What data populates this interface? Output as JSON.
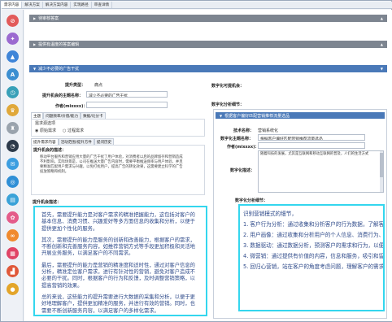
{
  "tabs": [
    "需求内容",
    "解决方案",
    "解决方案内容",
    "实现路径",
    "审查详情"
  ],
  "sidebar_icons": [
    {
      "name": "ban-icon",
      "color": "#e25a5a",
      "glyph": "⊘"
    },
    {
      "name": "puzzle-icon",
      "color": "#9b6ad0",
      "glyph": "✦"
    },
    {
      "name": "mountain-icon",
      "color": "#3f85d8",
      "glyph": "▲"
    },
    {
      "name": "abc-icon",
      "color": "#3c8fd1",
      "glyph": "A"
    },
    {
      "name": "clock-icon",
      "color": "#38a0b8",
      "glyph": "◷"
    },
    {
      "name": "trophy-icon",
      "color": "#e0a83a",
      "glyph": "♛"
    },
    {
      "name": "tower-icon",
      "color": "#9aa3ad",
      "glyph": "♜"
    },
    {
      "name": "gauge-icon",
      "color": "#2d3a4a",
      "glyph": "◔"
    },
    {
      "name": "chat-icon",
      "color": "#3d9ee0",
      "glyph": "✉"
    },
    {
      "name": "globe-icon",
      "color": "#2f8fd6",
      "glyph": "◎"
    },
    {
      "name": "document-icon",
      "color": "#3aa2d8",
      "glyph": "▤"
    },
    {
      "name": "palette-icon",
      "color": "#e45c8a",
      "glyph": "✿"
    },
    {
      "name": "link-icon",
      "color": "#f08a2e",
      "glyph": "∞"
    },
    {
      "name": "building-icon",
      "color": "#e04466",
      "glyph": "▦"
    },
    {
      "name": "podium-icon",
      "color": "#e0583a",
      "glyph": "▟"
    },
    {
      "name": "coin-icon",
      "color": "#e3a52a",
      "glyph": "●"
    }
  ],
  "sections": {
    "s1": "待审核答案",
    "s2": "提供有温度的答案编辑",
    "s3": "减少不必要的广告干扰"
  },
  "left": {
    "lbl_type": "提升类型：",
    "val_type": "痛点",
    "lbl_subject": "提升机会的主题名称：",
    "val_subject": "减少不必要的广告干扰",
    "lbl_author": "作者(mixxxx)：",
    "val_author": "",
    "subtabs_top": [
      "主题",
      "问题频率/价值/能力",
      "数据/论分卡"
    ],
    "need_source_label": "需求源选项",
    "radio1": "原始需求",
    "radio2": "过程需求",
    "subtabs_bottom": [
      "提升需求内容",
      "活动范围/提升方件",
      "提问历史"
    ],
    "desc_label": "提升机会的描述：",
    "desc_text": "移动平台服务和营销应用大量的广告干扰了用户体验，对消费者以后的品牌留存和营销造成不利影响。实际场景是，公司在推送大量广告内容时，需要平衡推送频率与用户体验，并且要精准匹配用户需求与兴趣，以免打扰用户，提高广告的转化效果，这需要建立科学的广告投放策略和机制。",
    "detail_label": "提升机会描述：",
    "paras": [
      "首先，需要提升能力是对客户需求的精准把握能力，这包括对客户的基本信息、消费习惯、兴趣爱好等多方面信息的收集和分析，以便于提供更加个性化的服务。",
      "其次，需要提升的能力是服务的创新和改善能力，根据客户的需求，不断创新和完善服务内容，如推荐营销方式等手段更加积极和灵活地开展业务服务，以满足客户的不同需求。",
      "最后，需要提升的能力是营销的精准度和适时性，通过对客户信息的分析，精准定位客户需求，进行有针对性的营销，避免对客户造成不必要的干扰。同时，根据客户的行为和反馈，及时调整营销策略，以提高营销的效果。",
      "总的来说，这些能力的提升需要进行大数据的采集和分析，以便于更好地理解客户，提供更加精准的服务，并进行有效的营销。同时，也需要不断创新服务内容，以满足客户的多样化需求。"
    ]
  },
  "right": {
    "rank_label": "数字化可提机会：",
    "analysis_label": "数字化分析细节：",
    "inner_title": "根据客户偏好匹配营销推荐流量选品",
    "lbl_tech": "技术名称：",
    "val_tech": "营销系统化",
    "lbl_topic": "数字化主题名称：",
    "val_topic": "根据客户偏好匹配营销推荐流量选品",
    "lbl_author": "作者(mixxxx)：",
    "val_author": "",
    "lbl_desc": "数字化描述：",
    "val_desc": "随着科技的发展，尤其是互联网和移动互联网的普及，人们的生活方式",
    "detail_label": "数字化分析细节：",
    "intro": "识别营销模式的细节，",
    "points": [
      "1. 客户行为分析：通过收集和分析客户的行为数据，了解客户的需",
      "2. 用户画像：通过收集和分析用户的个人信息、消费行为、社交行",
      "3. 数据驱动：通过数据分析，预测客户的需求和行为，以便在合适",
      "4. 微营销：通过提供有价值的内容，信息和服务，吸引和留住客",
      "5. 回归心营销，站在客户的角度考虑问题，理解客户的需求和痛点"
    ]
  }
}
